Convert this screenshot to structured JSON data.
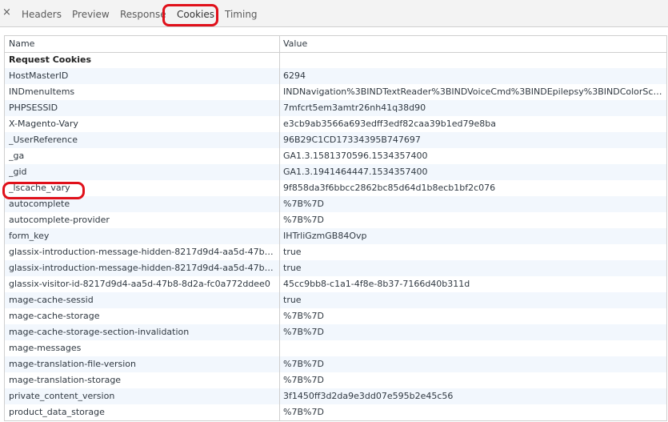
{
  "tabs": {
    "close_glyph": "×",
    "items": [
      "Headers",
      "Preview",
      "Response",
      "Cookies",
      "Timing"
    ],
    "active": "Cookies"
  },
  "table": {
    "columns": [
      "Name",
      "Value"
    ],
    "section_title": "Request Cookies",
    "rows": [
      {
        "name": "HostMasterID",
        "value": "6294"
      },
      {
        "name": "INDmenuItems",
        "value": "INDNavigation%3BINDTextReader%3BINDVoiceCmd%3BINDEpilepsy%3BINDColorSche..."
      },
      {
        "name": "PHPSESSID",
        "value": "7mfcrt5em3amtr26nh41q38d90"
      },
      {
        "name": "X-Magento-Vary",
        "value": "e3cb9ab3566a693edff3edf82caa39b1ed79e8ba"
      },
      {
        "name": "_UserReference",
        "value": "96B29C1CD17334395B747697"
      },
      {
        "name": "_ga",
        "value": "GA1.3.1581370596.1534357400"
      },
      {
        "name": "_gid",
        "value": "GA1.3.1941464447.1534357400"
      },
      {
        "name": "_lscache_vary",
        "value": "9f858da3f6bbcc2862bc85d64d1b8ecb1bf2c076"
      },
      {
        "name": "autocomplete",
        "value": "%7B%7D"
      },
      {
        "name": "autocomplete-provider",
        "value": "%7B%7D"
      },
      {
        "name": "form_key",
        "value": "IHTrliGzmGB84Ovp"
      },
      {
        "name": "glassix-introduction-message-hidden-8217d9d4-aa5d-47b8-...",
        "value": "true"
      },
      {
        "name": "glassix-introduction-message-hidden-8217d9d4-aa5d-47b8-...",
        "value": "true"
      },
      {
        "name": "glassix-visitor-id-8217d9d4-aa5d-47b8-8d2a-fc0a772ddee0",
        "value": "45cc9bb8-c1a1-4f8e-8b37-7166d40b311d"
      },
      {
        "name": "mage-cache-sessid",
        "value": "true"
      },
      {
        "name": "mage-cache-storage",
        "value": "%7B%7D"
      },
      {
        "name": "mage-cache-storage-section-invalidation",
        "value": "%7B%7D"
      },
      {
        "name": "mage-messages",
        "value": ""
      },
      {
        "name": "mage-translation-file-version",
        "value": "%7B%7D"
      },
      {
        "name": "mage-translation-storage",
        "value": "%7B%7D"
      },
      {
        "name": "private_content_version",
        "value": "3f1450ff3d2da9e3dd07e595b2e45c56"
      },
      {
        "name": "product_data_storage",
        "value": "%7B%7D"
      }
    ]
  },
  "colors": {
    "highlight": "#e0101a",
    "row_alt": "#f2f7fd",
    "border": "#cfcfcf"
  }
}
